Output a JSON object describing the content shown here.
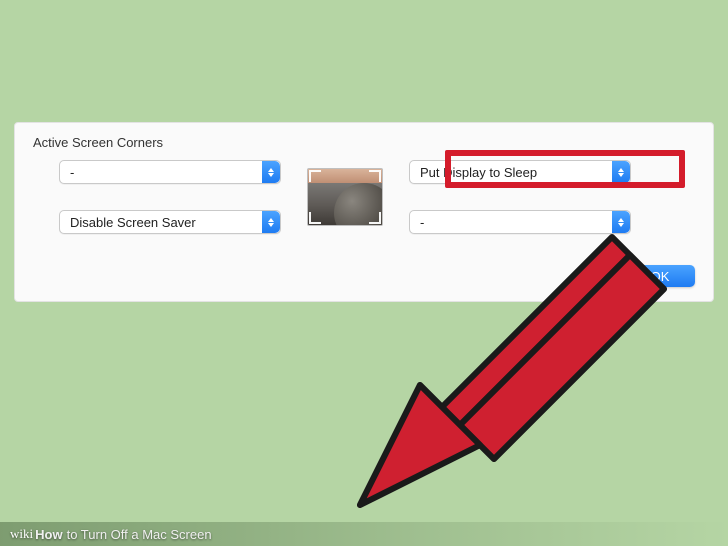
{
  "panel": {
    "title": "Active Screen Corners",
    "topLeft": "-",
    "bottomLeft": "Disable Screen Saver",
    "topRight": "Put Display to Sleep",
    "bottomRight": "-",
    "okLabel": "OK"
  },
  "banner": {
    "brand": "wiki",
    "how": "How",
    "title": "to Turn Off a Mac Screen"
  },
  "colors": {
    "highlight": "#d41c2b",
    "accent": "#1e7bf2",
    "background": "#b5d5a4"
  }
}
